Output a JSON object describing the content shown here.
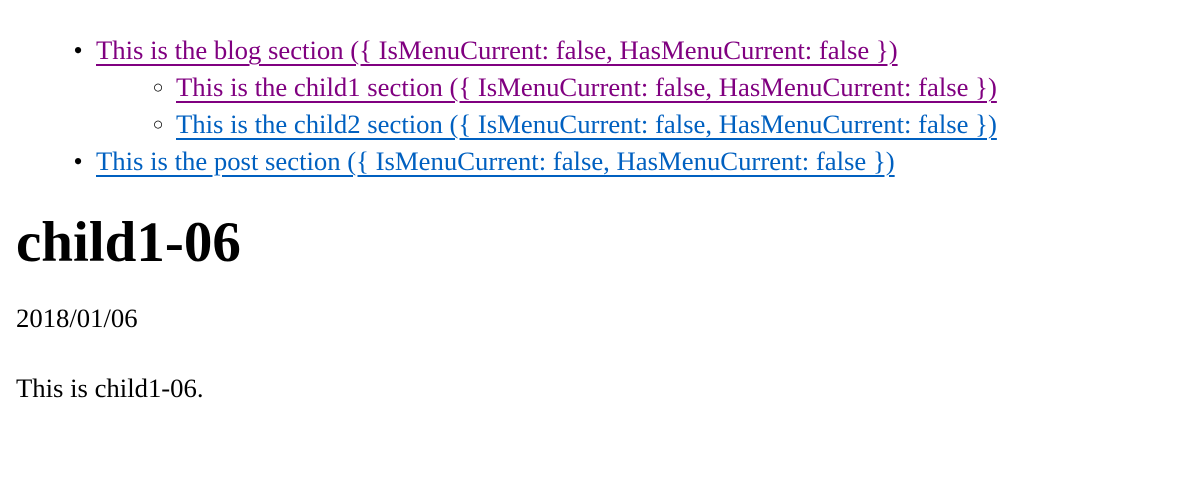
{
  "menu": {
    "items": [
      {
        "label": "This is the blog section ({ IsMenuCurrent: false, HasMenuCurrent: false })",
        "visited": true,
        "children": [
          {
            "label": "This is the child1 section ({ IsMenuCurrent: false, HasMenuCurrent: false })",
            "visited": true
          },
          {
            "label": "This is the child2 section ({ IsMenuCurrent: false, HasMenuCurrent: false })",
            "visited": false
          }
        ]
      },
      {
        "label": "This is the post section ({ IsMenuCurrent: false, HasMenuCurrent: false })",
        "visited": false,
        "children": []
      }
    ]
  },
  "post": {
    "title": "child1-06",
    "date": "2018/01/06",
    "body": "This is child1-06."
  },
  "colors": {
    "visited_link": "#800080",
    "unvisited_link": "#0060c0",
    "text": "#000000",
    "background": "#ffffff"
  }
}
